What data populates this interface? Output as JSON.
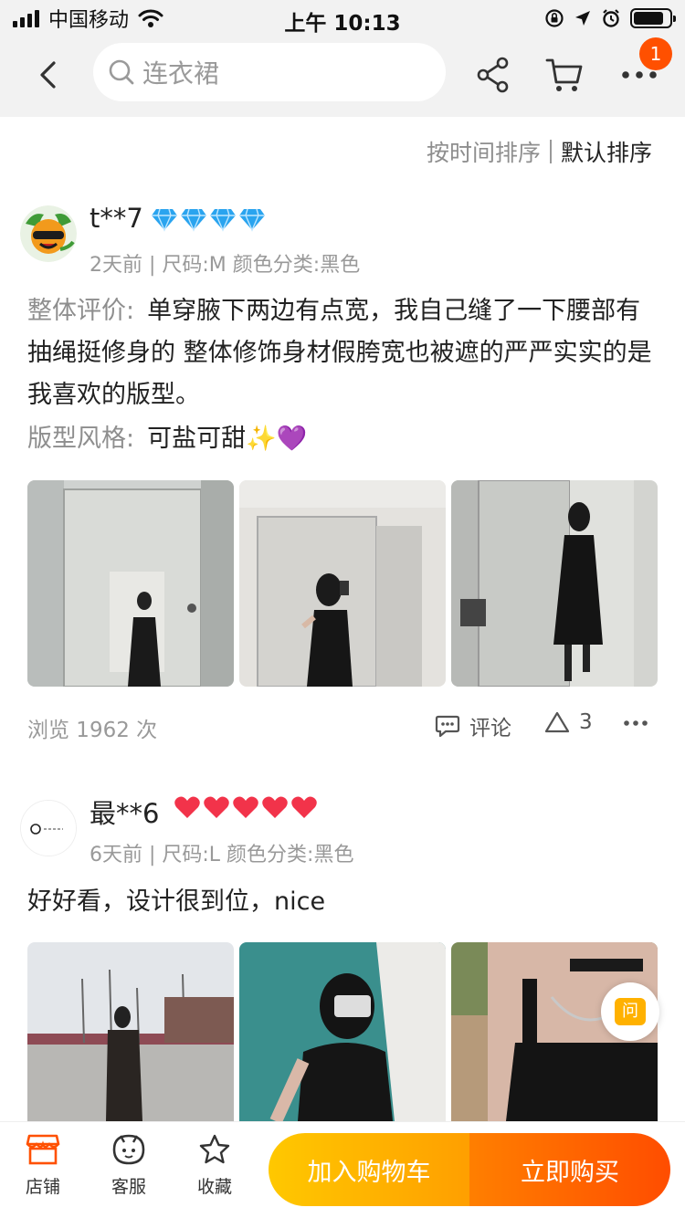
{
  "status_bar": {
    "carrier": "中国移动",
    "time": "上午 10:13"
  },
  "header": {
    "search_placeholder": "连衣裙",
    "badge_count": "1"
  },
  "sort": {
    "by_time": "按时间排序",
    "default": "默认排序"
  },
  "reviews": [
    {
      "user": "t**7",
      "level_icon": "diamond-icon",
      "level_count": 4,
      "meta": "2天前 | 尺码:M 颜色分类:黑色",
      "lines": [
        {
          "label": "整体评价:",
          "text": "单穿腋下两边有点宽，我自己缝了一下腰部有抽绳挺修身的 整体修饰身材假胯宽也被遮的严严实实的是我喜欢的版型。"
        },
        {
          "label": "版型风格:",
          "text": "可盐可甜✨💜"
        }
      ],
      "views": "浏览 1962 次",
      "comment_label": "评论",
      "likes": "3"
    },
    {
      "user": "最**6",
      "level_icon": "heart-icon",
      "level_count": 5,
      "meta": "6天前 | 尺码:L 颜色分类:黑色",
      "text": "好好看，设计很到位，nice"
    }
  ],
  "ask_button": "问",
  "bottom_bar": {
    "shop": "店铺",
    "service": "客服",
    "favorite": "收藏",
    "add_to_cart": "加入购物车",
    "buy_now": "立即购买"
  },
  "colors": {
    "accent": "#ff5000",
    "cart": "#ffb400",
    "buy": "#ff6000",
    "diamond": "#2aa4ef",
    "heart": "#f2334a"
  }
}
